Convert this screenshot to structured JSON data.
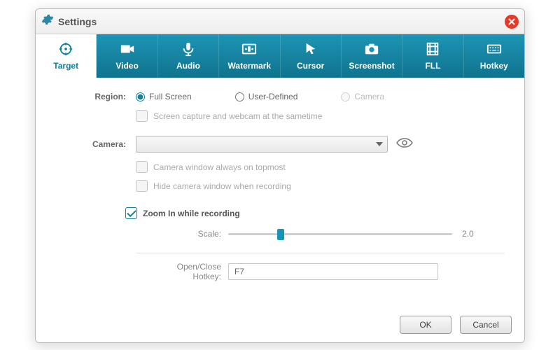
{
  "window": {
    "title": "Settings"
  },
  "tabs": [
    {
      "label": "Target"
    },
    {
      "label": "Video"
    },
    {
      "label": "Audio"
    },
    {
      "label": "Watermark"
    },
    {
      "label": "Cursor"
    },
    {
      "label": "Screenshot"
    },
    {
      "label": "FLL"
    },
    {
      "label": "Hotkey"
    }
  ],
  "region": {
    "label": "Region:",
    "options": {
      "full": "Full Screen",
      "user": "User-Defined",
      "camera": "Camera"
    },
    "selected": "full",
    "sametime_label": "Screen capture and webcam at the sametime"
  },
  "camera": {
    "label": "Camera:",
    "value": "",
    "topmost_label": "Camera window always on topmost",
    "hide_label": "Hide camera window when recording"
  },
  "zoom": {
    "enable_label": "Zoom In while recording",
    "enabled": true,
    "scale_label": "Scale:",
    "scale_value": "2.0",
    "thumb_percent": 22,
    "hotkey_label": "Open/Close Hotkey:",
    "hotkey_value": "F7"
  },
  "footer": {
    "ok": "OK",
    "cancel": "Cancel"
  }
}
